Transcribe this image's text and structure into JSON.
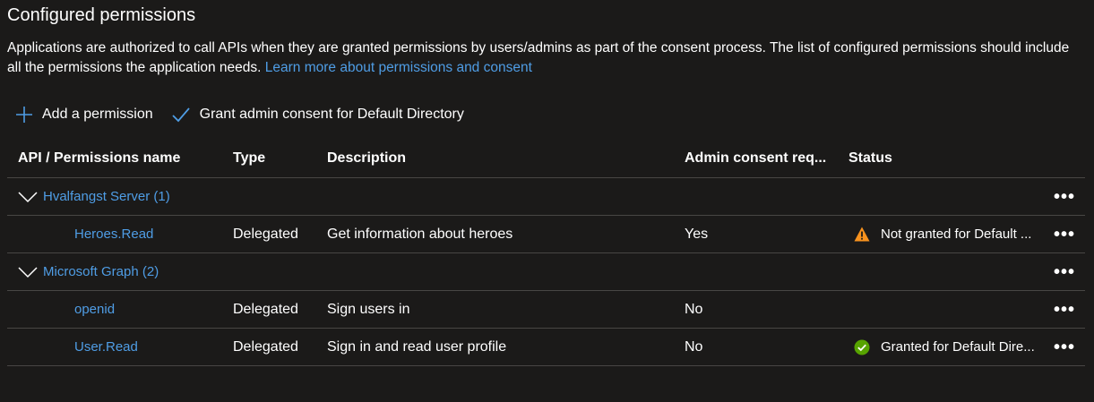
{
  "page": {
    "title": "Configured permissions",
    "description": "Applications are authorized to call APIs when they are granted permissions by users/admins as part of the consent process. The list of configured permissions should include all the permissions the application needs. ",
    "learn_more_link": "Learn more about permissions and consent"
  },
  "toolbar": {
    "add_label": "Add a permission",
    "grant_label": "Grant admin consent for Default Directory"
  },
  "table": {
    "headers": {
      "name": "API / Permissions name",
      "type": "Type",
      "description": "Description",
      "admin": "Admin consent req...",
      "status": "Status"
    },
    "groups": [
      {
        "name": "Hvalfangst Server (1)",
        "permissions": [
          {
            "name": "Heroes.Read",
            "type": "Delegated",
            "description": "Get information about heroes",
            "admin": "Yes",
            "status": "Not granted for Default ...",
            "status_icon": "warning-icon"
          }
        ]
      },
      {
        "name": "Microsoft Graph (2)",
        "permissions": [
          {
            "name": "openid",
            "type": "Delegated",
            "description": "Sign users in",
            "admin": "No",
            "status": "",
            "status_icon": ""
          },
          {
            "name": "User.Read",
            "type": "Delegated",
            "description": "Sign in and read user profile",
            "admin": "No",
            "status": "Granted for Default Dire...",
            "status_icon": "check-circle-icon"
          }
        ]
      }
    ]
  },
  "colors": {
    "background": "#1b1a19",
    "link": "#4f9de5",
    "warning": "#f7921e",
    "success": "#57a300",
    "divider": "#484644"
  },
  "more_label": "•••"
}
